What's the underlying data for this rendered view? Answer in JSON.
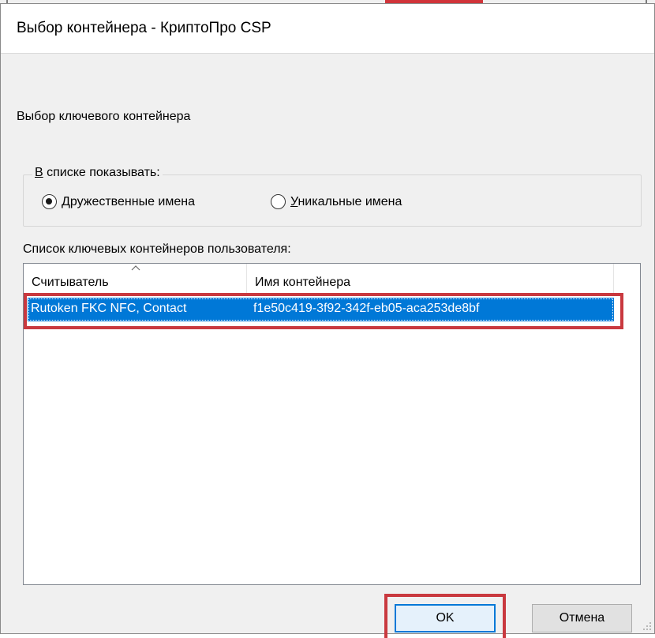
{
  "window": {
    "title": "Выбор контейнера - КриптоПро CSP"
  },
  "dialog": {
    "subtitle": "Выбор ключевого контейнера",
    "show_group": {
      "legend_hotkey": "В",
      "legend_rest": " списке показывать:",
      "options": [
        {
          "hotkey": "Д",
          "rest": "ружественные имена",
          "checked": true
        },
        {
          "hotkey": "У",
          "rest": "никальные имена",
          "checked": false
        }
      ]
    },
    "list_label": "Список ключевых контейнеров пользователя:",
    "list": {
      "columns": [
        "Считыватель",
        "Имя контейнера"
      ],
      "sorted_column": "Считыватель",
      "rows": [
        {
          "reader": "Rutoken FKC NFC, Contact",
          "container": "f1e50c419-3f92-342f-eb05-aca253de8bf",
          "selected": true
        }
      ]
    },
    "buttons": {
      "ok": "OK",
      "cancel": "Отмена"
    }
  },
  "colors": {
    "selection": "#0078d7",
    "annotation": "#c9393f",
    "dialog_bg": "#f0f0f0"
  }
}
